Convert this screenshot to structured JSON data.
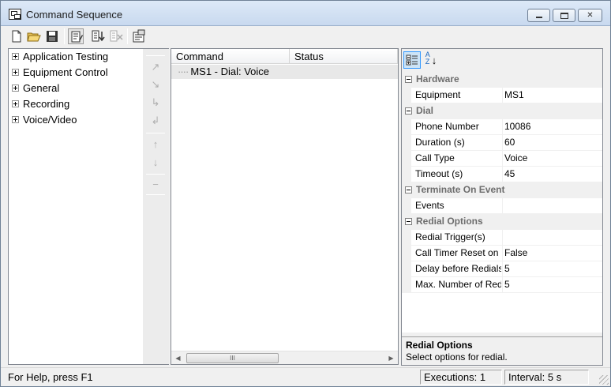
{
  "window": {
    "title": "Command Sequence",
    "icon": "command-sequence-app-icon",
    "controls": [
      "minimize-icon",
      "maximize-icon",
      "close-icon"
    ]
  },
  "toolbar": {
    "buttons": [
      {
        "name": "new-icon"
      },
      {
        "name": "open-folder-icon"
      },
      {
        "name": "save-icon"
      },
      {
        "name": "edit-sequence-icon"
      },
      {
        "name": "insert-command-icon"
      },
      {
        "name": "delete-command-icon"
      },
      {
        "name": "properties-icon"
      }
    ]
  },
  "tree": {
    "items": [
      {
        "label": "Application Testing"
      },
      {
        "label": "Equipment Control"
      },
      {
        "label": "General"
      },
      {
        "label": "Recording"
      },
      {
        "label": "Voice/Video"
      }
    ]
  },
  "side_buttons": [
    "add-arrow-icon",
    "add-down-arrow-icon",
    "insert-right-icon",
    "insert-left-icon",
    "move-up-icon",
    "move-down-icon",
    "remove-icon"
  ],
  "command_list": {
    "columns": [
      "Command",
      "Status"
    ],
    "rows": [
      {
        "command": "MS1 - Dial: Voice",
        "status": ""
      }
    ],
    "scroll_thumb_label": "III"
  },
  "property_grid": {
    "toolbar": [
      "categorized-view-icon",
      "alphabetical-sort-icon"
    ],
    "sort_label": "AZ",
    "categories": [
      {
        "name": "Hardware",
        "properties": [
          {
            "name": "Equipment",
            "value": "MS1"
          }
        ]
      },
      {
        "name": "Dial",
        "properties": [
          {
            "name": "Phone Number",
            "value": "10086"
          },
          {
            "name": "Duration (s)",
            "value": "60"
          },
          {
            "name": "Call Type",
            "value": "Voice"
          },
          {
            "name": "Timeout (s)",
            "value": "45"
          }
        ]
      },
      {
        "name": "Terminate On Event",
        "properties": [
          {
            "name": "Events",
            "value": ""
          }
        ]
      },
      {
        "name": "Redial Options",
        "properties": [
          {
            "name": "Redial Trigger(s)",
            "value": ""
          },
          {
            "name": "Call Timer Reset on",
            "value": "False"
          },
          {
            "name": "Delay before Redials",
            "value": "5"
          },
          {
            "name": "Max. Number of Redials",
            "value": "5"
          }
        ]
      }
    ],
    "description": {
      "title": "Redial Options",
      "text": "Select options for redial."
    }
  },
  "statusbar": {
    "help": "For Help, press F1",
    "executions": "Executions: 1",
    "interval": "Interval: 5 s"
  }
}
